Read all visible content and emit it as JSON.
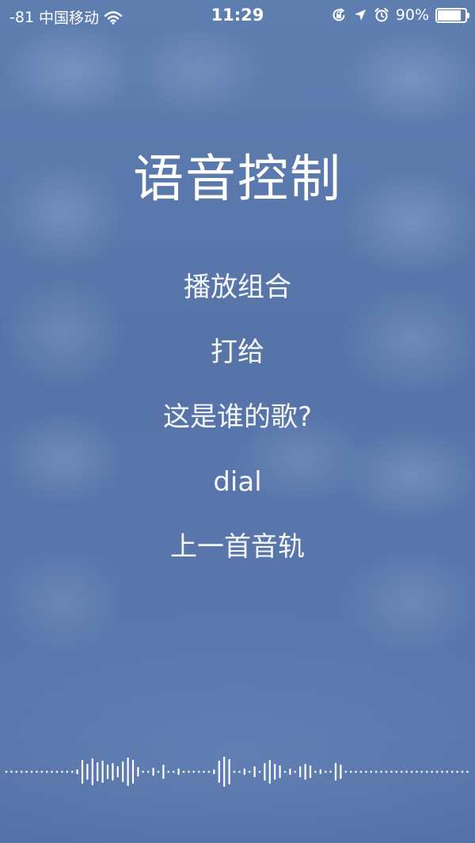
{
  "status_bar": {
    "signal": "-81",
    "carrier": "中国移动",
    "time": "11:29",
    "battery_text": "90%",
    "battery_level": 0.9,
    "icons": [
      "wifi-icon",
      "rotation-lock-icon",
      "location-arrow-icon",
      "alarm-icon",
      "battery-icon"
    ]
  },
  "voice_control": {
    "title": "语音控制",
    "suggestions": [
      "播放组合",
      "打给",
      "这是谁的歌?",
      "dial",
      "上一首音轨"
    ]
  },
  "colors": {
    "background": "#5a78a9",
    "text": "#ffffff"
  }
}
